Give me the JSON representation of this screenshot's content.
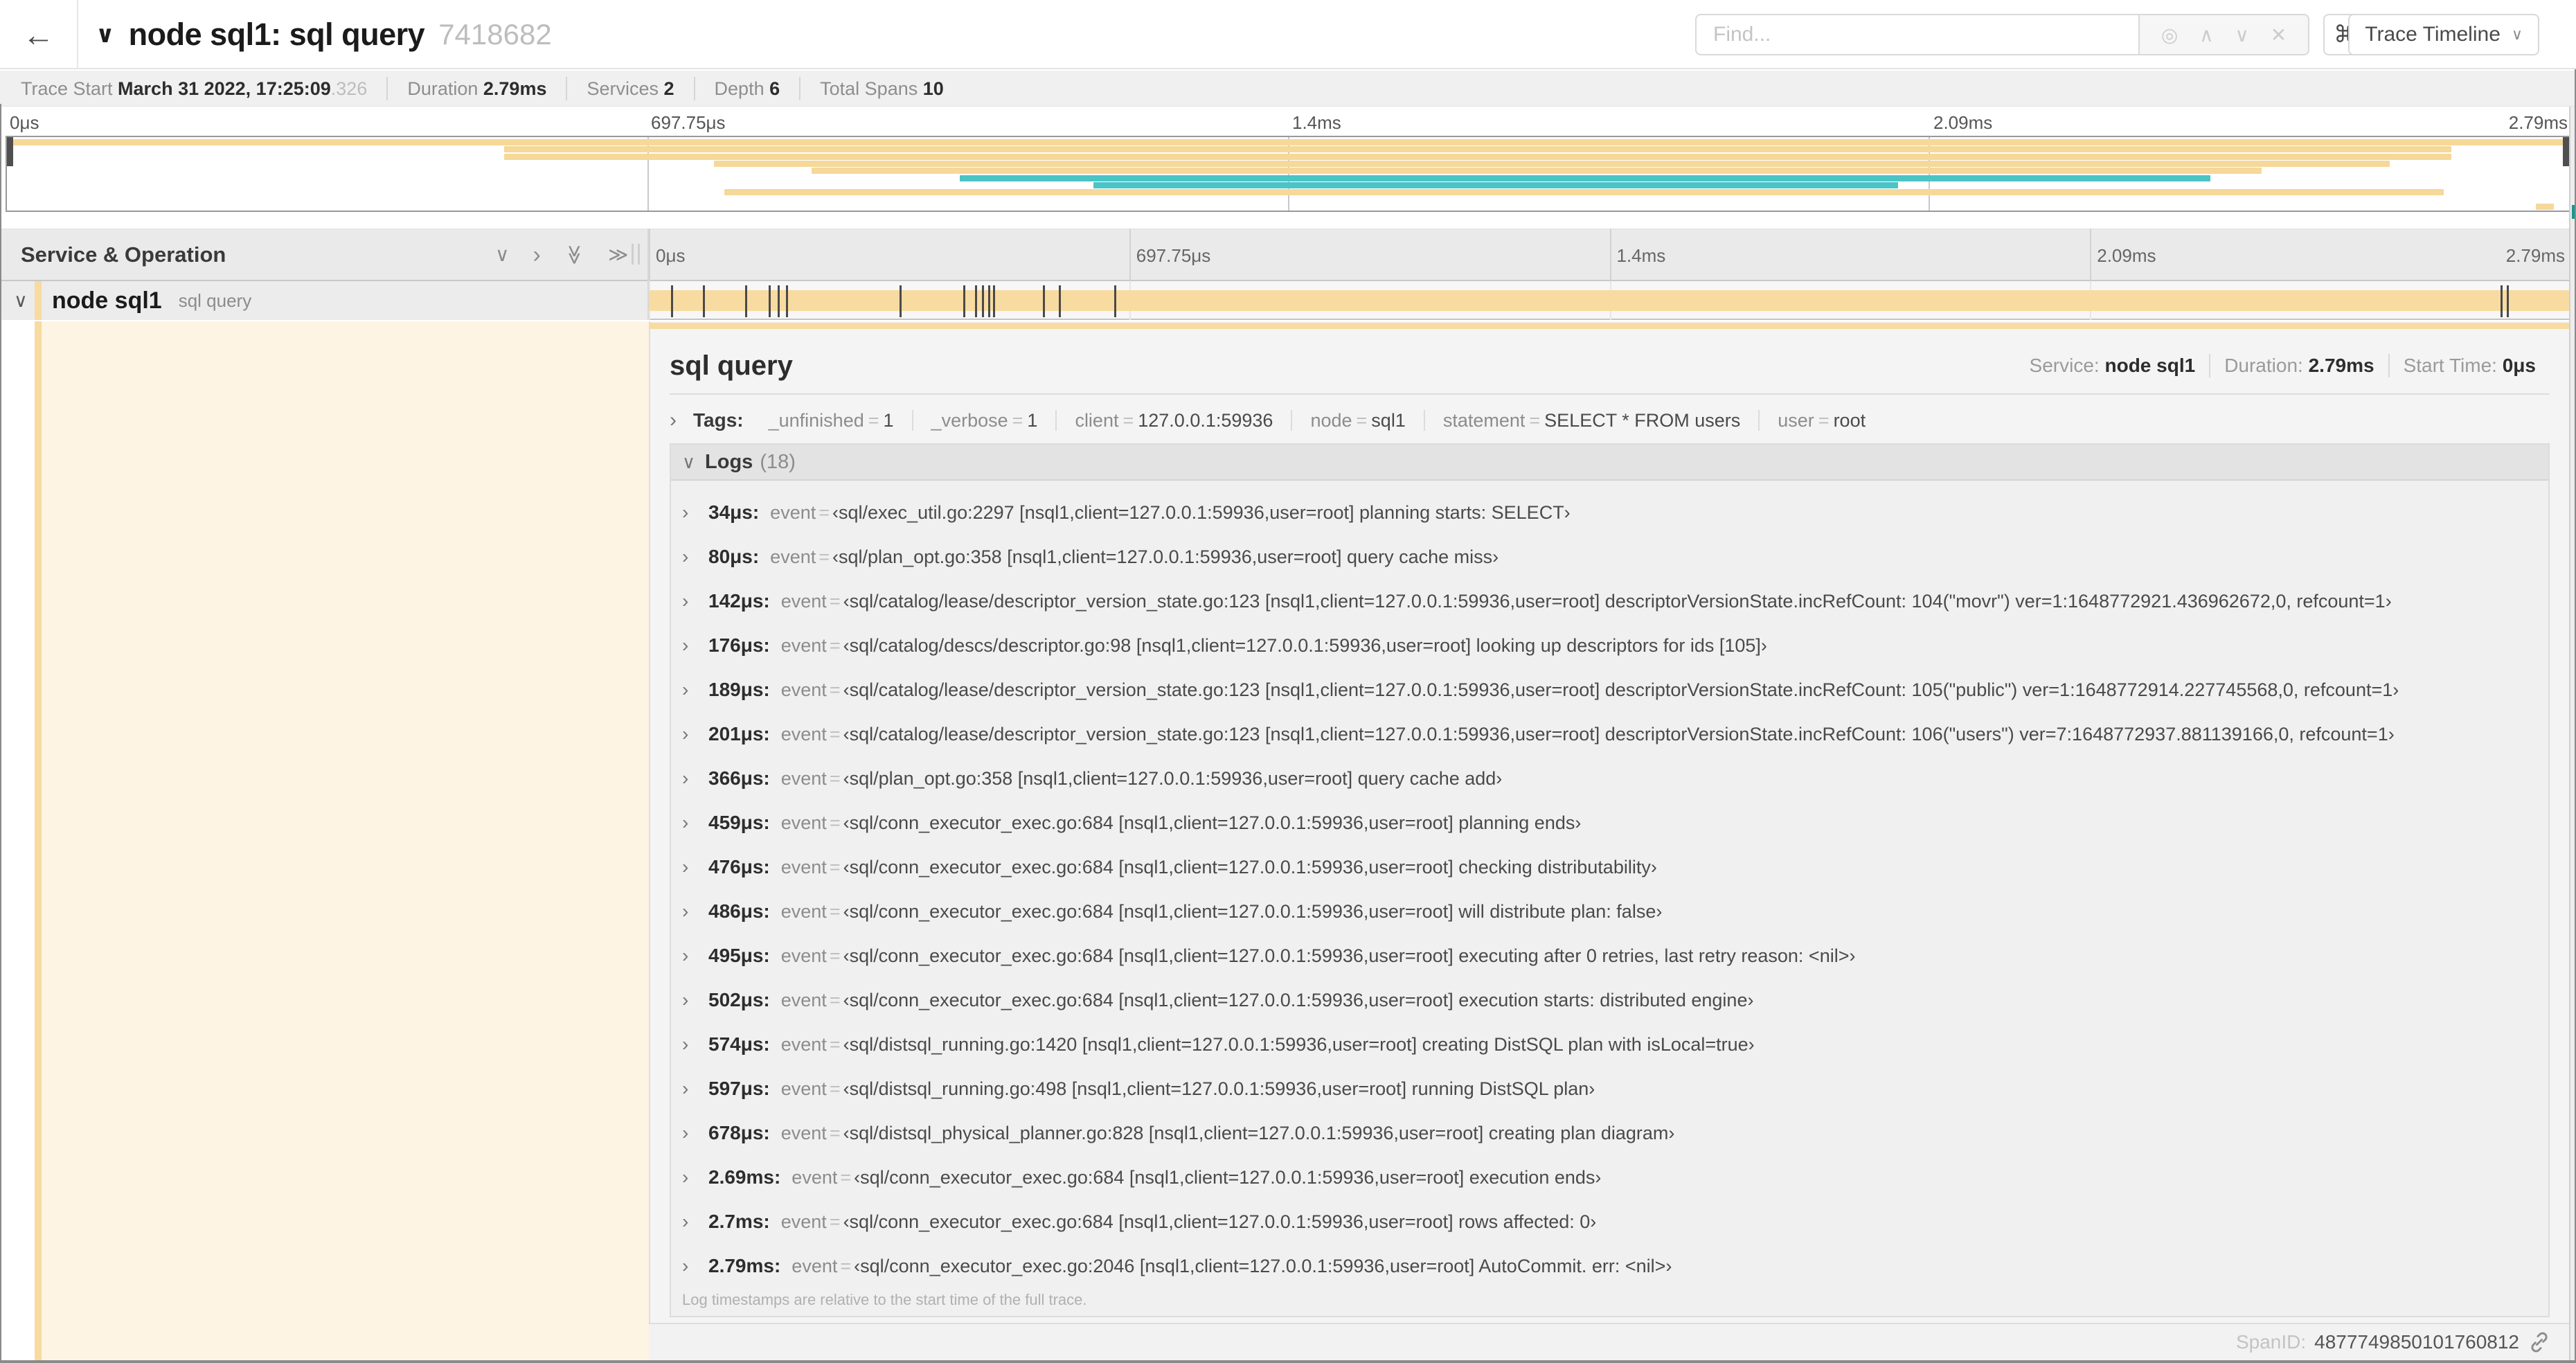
{
  "colors": {
    "tan": "#F6D899",
    "tan_bar": "#F8DBA0",
    "teal": "#4AC4C4",
    "cream": "#FDF4E3",
    "rail_teal": "#18978F"
  },
  "header": {
    "back_icon": "←",
    "collapse_icon": "∨",
    "title": "node sql1: sql query",
    "trace_id": "7418682",
    "find_placeholder": "Find...",
    "find_tools": {
      "locate_icon": "◎",
      "prev_icon": "∧",
      "next_icon": "∨",
      "clear_icon": "✕"
    },
    "shortcut_icon": "⌘",
    "view_label": "Trace Timeline",
    "view_dropdown_icon": "∨"
  },
  "summary": {
    "items": [
      {
        "label": "Trace Start",
        "value": "March 31 2022, 17:25:09",
        "suffix": ".326"
      },
      {
        "label": "Duration",
        "value": "2.79ms",
        "suffix": ""
      },
      {
        "label": "Services",
        "value": "2",
        "suffix": ""
      },
      {
        "label": "Depth",
        "value": "6",
        "suffix": ""
      },
      {
        "label": "Total Spans",
        "value": "10",
        "suffix": ""
      }
    ]
  },
  "minimap": {
    "tick_labels": [
      "0μs",
      "697.75μs",
      "1.4ms",
      "2.09ms",
      "2.79ms"
    ],
    "tick_positions": [
      0,
      25,
      50,
      75,
      100
    ],
    "spans": [
      {
        "start": 0,
        "end": 100,
        "color": "tan"
      },
      {
        "start": 19.4,
        "end": 95.4,
        "color": "tan"
      },
      {
        "start": 19.4,
        "end": 95.4,
        "color": "tan"
      },
      {
        "start": 27.6,
        "end": 93.0,
        "color": "tan"
      },
      {
        "start": 31.4,
        "end": 88.0,
        "color": "tan"
      },
      {
        "start": 37.2,
        "end": 86.0,
        "color": "teal"
      },
      {
        "start": 42.4,
        "end": 73.8,
        "color": "teal"
      },
      {
        "start": 28.0,
        "end": 95.1,
        "color": "tan"
      },
      {
        "start": 0,
        "end": 0,
        "color": "tan"
      },
      {
        "start": 98.7,
        "end": 99.4,
        "color": "tan"
      }
    ]
  },
  "timeline": {
    "header_label": "Service & Operation",
    "collapse_icons": {
      "collapse_one": "∨",
      "expand_one": "›",
      "collapse_all": "≫",
      "expand_all": "≫"
    },
    "tick_labels": [
      "0μs",
      "697.75μs",
      "1.4ms",
      "2.09ms",
      "2.79ms"
    ],
    "tick_positions": [
      0,
      25,
      50,
      75,
      100
    ],
    "row": {
      "chevron_icon": "∨",
      "service": "node sql1",
      "operation": "sql query",
      "bar_start": 0,
      "bar_end": 100,
      "log_marks": [
        1.22,
        2.87,
        5.09,
        6.31,
        6.77,
        7.2,
        13.12,
        16.45,
        17.06,
        17.42,
        17.74,
        17.99,
        20.57,
        21.4,
        24.3,
        96.42,
        96.77,
        100
      ]
    }
  },
  "detail": {
    "title": "sql query",
    "meta": {
      "service_label": "Service:",
      "service": "node sql1",
      "duration_label": "Duration:",
      "duration": "2.79ms",
      "start_label": "Start Time:",
      "start": "0μs"
    },
    "tags": {
      "chevron_icon": "›",
      "label": "Tags:",
      "items": [
        {
          "key": "_unfinished",
          "value": "1"
        },
        {
          "key": "_verbose",
          "value": "1"
        },
        {
          "key": "client",
          "value": "127.0.0.1:59936"
        },
        {
          "key": "node",
          "value": "sql1"
        },
        {
          "key": "statement",
          "value": "SELECT * FROM users"
        },
        {
          "key": "user",
          "value": "root"
        }
      ]
    },
    "logs": {
      "chevron_icon": "∨",
      "label": "Logs",
      "count": "(18)",
      "entry_chevron_icon": "›",
      "entry_key": "event",
      "entries": [
        {
          "time": "34μs:",
          "value": "‹sql/exec_util.go:2297 [nsql1,client=127.0.0.1:59936,user=root] planning starts: SELECT›"
        },
        {
          "time": "80μs:",
          "value": "‹sql/plan_opt.go:358 [nsql1,client=127.0.0.1:59936,user=root] query cache miss›"
        },
        {
          "time": "142μs:",
          "value": "‹sql/catalog/lease/descriptor_version_state.go:123 [nsql1,client=127.0.0.1:59936,user=root] descriptorVersionState.incRefCount: 104(\"movr\") ver=1:1648772921.436962672,0, refcount=1›"
        },
        {
          "time": "176μs:",
          "value": "‹sql/catalog/descs/descriptor.go:98 [nsql1,client=127.0.0.1:59936,user=root] looking up descriptors for ids [105]›"
        },
        {
          "time": "189μs:",
          "value": "‹sql/catalog/lease/descriptor_version_state.go:123 [nsql1,client=127.0.0.1:59936,user=root] descriptorVersionState.incRefCount: 105(\"public\") ver=1:1648772914.227745568,0, refcount=1›"
        },
        {
          "time": "201μs:",
          "value": "‹sql/catalog/lease/descriptor_version_state.go:123 [nsql1,client=127.0.0.1:59936,user=root] descriptorVersionState.incRefCount: 106(\"users\") ver=7:1648772937.881139166,0, refcount=1›"
        },
        {
          "time": "366μs:",
          "value": "‹sql/plan_opt.go:358 [nsql1,client=127.0.0.1:59936,user=root] query cache add›"
        },
        {
          "time": "459μs:",
          "value": "‹sql/conn_executor_exec.go:684 [nsql1,client=127.0.0.1:59936,user=root] planning ends›"
        },
        {
          "time": "476μs:",
          "value": "‹sql/conn_executor_exec.go:684 [nsql1,client=127.0.0.1:59936,user=root] checking distributability›"
        },
        {
          "time": "486μs:",
          "value": "‹sql/conn_executor_exec.go:684 [nsql1,client=127.0.0.1:59936,user=root] will distribute plan: false›"
        },
        {
          "time": "495μs:",
          "value": "‹sql/conn_executor_exec.go:684 [nsql1,client=127.0.0.1:59936,user=root] executing after 0 retries, last retry reason: <nil>›"
        },
        {
          "time": "502μs:",
          "value": "‹sql/conn_executor_exec.go:684 [nsql1,client=127.0.0.1:59936,user=root] execution starts: distributed engine›"
        },
        {
          "time": "574μs:",
          "value": "‹sql/distsql_running.go:1420 [nsql1,client=127.0.0.1:59936,user=root] creating DistSQL plan with isLocal=true›"
        },
        {
          "time": "597μs:",
          "value": "‹sql/distsql_running.go:498 [nsql1,client=127.0.0.1:59936,user=root] running DistSQL plan›"
        },
        {
          "time": "678μs:",
          "value": "‹sql/distsql_physical_planner.go:828 [nsql1,client=127.0.0.1:59936,user=root] creating plan diagram›"
        },
        {
          "time": "2.69ms:",
          "value": "‹sql/conn_executor_exec.go:684 [nsql1,client=127.0.0.1:59936,user=root] execution ends›"
        },
        {
          "time": "2.7ms:",
          "value": "‹sql/conn_executor_exec.go:684 [nsql1,client=127.0.0.1:59936,user=root] rows affected: 0›"
        },
        {
          "time": "2.79ms:",
          "value": "‹sql/conn_executor_exec.go:2046 [nsql1,client=127.0.0.1:59936,user=root] AutoCommit. err: <nil>›"
        }
      ],
      "footnote": "Log timestamps are relative to the start time of the full trace."
    },
    "footer": {
      "span_id_label": "SpanID:",
      "span_id": "4877749850101760812"
    }
  }
}
